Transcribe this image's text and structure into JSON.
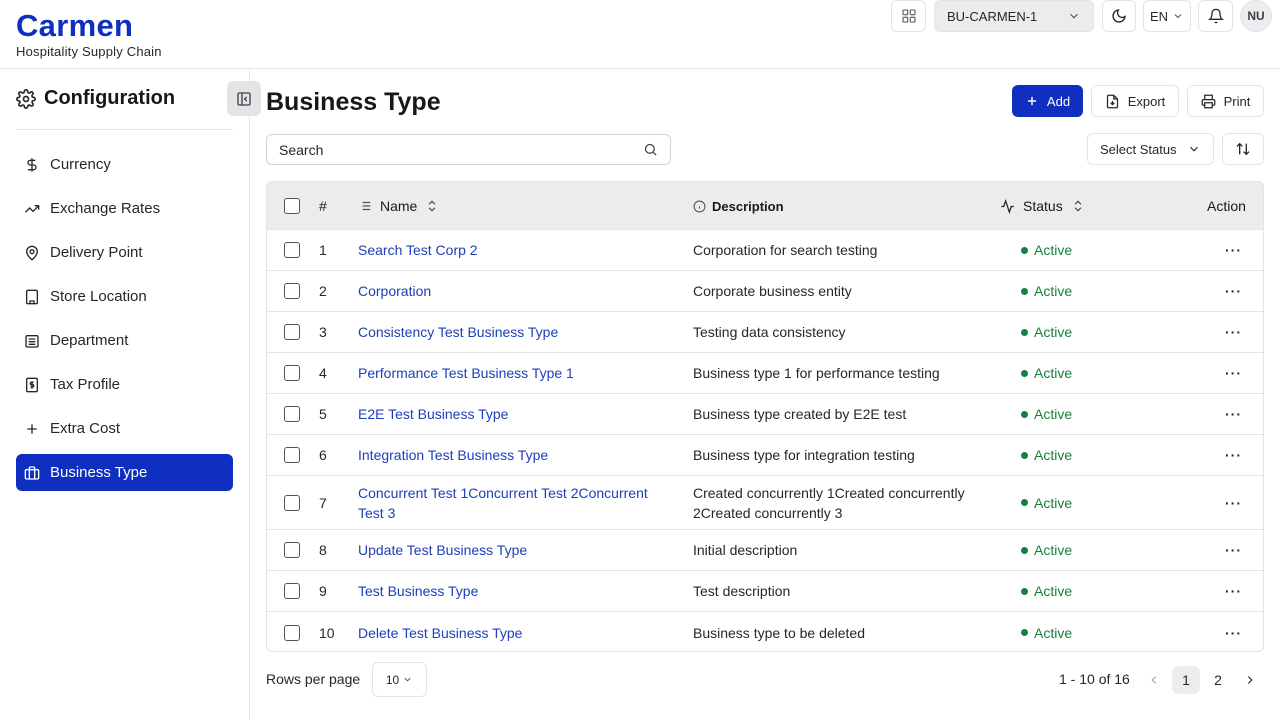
{
  "app": {
    "brand_name": "Carmen",
    "brand_subtitle": "Hospitality Supply Chain"
  },
  "topbar": {
    "business_unit": "BU-CARMEN-1",
    "language": "EN",
    "user_initials": "NU"
  },
  "sidebar": {
    "title": "Configuration",
    "items": [
      {
        "label": "Currency",
        "icon": "dollar-icon",
        "active": false
      },
      {
        "label": "Exchange Rates",
        "icon": "trending-up-icon",
        "active": false
      },
      {
        "label": "Delivery Point",
        "icon": "map-pin-icon",
        "active": false
      },
      {
        "label": "Store Location",
        "icon": "building-icon",
        "active": false
      },
      {
        "label": "Department",
        "icon": "landmark-icon",
        "active": false
      },
      {
        "label": "Tax Profile",
        "icon": "receipt-icon",
        "active": false
      },
      {
        "label": "Extra Cost",
        "icon": "plus-icon",
        "active": false
      },
      {
        "label": "Business Type",
        "icon": "briefcase-icon",
        "active": true
      }
    ]
  },
  "page": {
    "title": "Business Type",
    "add_label": "Add",
    "export_label": "Export",
    "print_label": "Print"
  },
  "filters": {
    "search_placeholder": "Search",
    "status_label": "Select Status"
  },
  "table": {
    "columns": {
      "index": "#",
      "name": "Name",
      "description": "Description",
      "status": "Status",
      "action": "Action"
    },
    "rows": [
      {
        "index": "1",
        "name": "Search Test Corp 2",
        "description": "Corporation for search testing",
        "status": "Active"
      },
      {
        "index": "2",
        "name": "Corporation",
        "description": "Corporate business entity",
        "status": "Active"
      },
      {
        "index": "3",
        "name": "Consistency Test Business Type",
        "description": "Testing data consistency",
        "status": "Active"
      },
      {
        "index": "4",
        "name": "Performance Test Business Type 1",
        "description": "Business type 1 for performance testing",
        "status": "Active"
      },
      {
        "index": "5",
        "name": "E2E Test Business Type",
        "description": "Business type created by E2E test",
        "status": "Active"
      },
      {
        "index": "6",
        "name": "Integration Test Business Type",
        "description": "Business type for integration testing",
        "status": "Active"
      },
      {
        "index": "7",
        "name": "Concurrent Test 1Concurrent Test 2Concurrent Test 3",
        "description": "Created concurrently 1Created concurrently 2Created concurrently 3",
        "status": "Active"
      },
      {
        "index": "8",
        "name": "Update Test Business Type",
        "description": "Initial description",
        "status": "Active"
      },
      {
        "index": "9",
        "name": "Test Business Type",
        "description": "Test description",
        "status": "Active"
      },
      {
        "index": "10",
        "name": "Delete Test Business Type",
        "description": "Business type to be deleted",
        "status": "Active"
      }
    ],
    "action_glyph": "···"
  },
  "pagination": {
    "rows_per_page_label": "Rows per page",
    "rows_per_page_value": "10",
    "range_text": "1 - 10 of 16",
    "pages": [
      "1",
      "2"
    ],
    "current_page": "1"
  },
  "colors": {
    "brand": "#0e2fbf",
    "link": "#1d3fb8",
    "status_active": "#15803d"
  }
}
